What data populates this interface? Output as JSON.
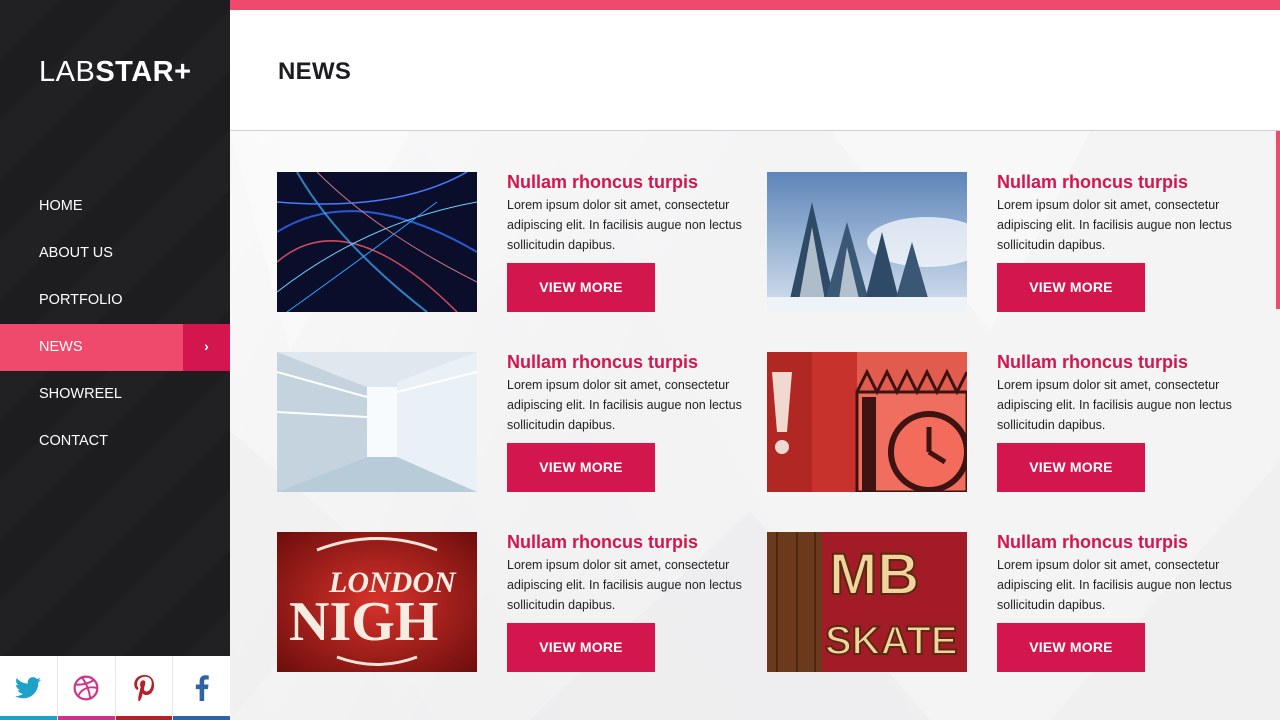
{
  "brand": {
    "logo_light": "LAB",
    "logo_bold": "STAR",
    "logo_plus": "+"
  },
  "nav": {
    "items": [
      {
        "label": "HOME"
      },
      {
        "label": "ABOUT US"
      },
      {
        "label": "PORTFOLIO"
      },
      {
        "label": "NEWS",
        "active": true,
        "chevron": "›"
      },
      {
        "label": "SHOWREEL"
      },
      {
        "label": "CONTACT"
      }
    ]
  },
  "social": [
    {
      "icon": "twitter-icon",
      "color": "#1da1c8"
    },
    {
      "icon": "dribbble-icon",
      "color": "#d4308a"
    },
    {
      "icon": "pinterest-icon",
      "color": "#b5202a"
    },
    {
      "icon": "facebook-icon",
      "color": "#2f63a8"
    }
  ],
  "page": {
    "title": "NEWS"
  },
  "colors": {
    "accent": "#ef4a6b",
    "accent_dark": "#d4164f",
    "sidebar": "#1d1d1f"
  },
  "news": [
    {
      "title": "Nullam rhoncus turpis",
      "body": "Lorem ipsum dolor sit amet, consectetur adipiscing elit. In facilisis augue non lectus sollicitudin dapibus.",
      "button": "VIEW MORE",
      "image": "light-streaks"
    },
    {
      "title": "Nullam rhoncus turpis",
      "body": "Lorem ipsum dolor sit amet, consectetur adipiscing elit. In facilisis augue non lectus sollicitudin dapibus.",
      "button": "VIEW MORE",
      "image": "snowy-trees"
    },
    {
      "title": "Nullam rhoncus turpis",
      "body": "Lorem ipsum dolor sit amet, consectetur adipiscing elit. In facilisis augue non lectus sollicitudin dapibus.",
      "button": "VIEW MORE",
      "image": "white-corridor"
    },
    {
      "title": "Nullam rhoncus turpis",
      "body": "Lorem ipsum dolor sit amet, consectetur adipiscing elit. In facilisis augue non lectus sollicitudin dapibus.",
      "button": "VIEW MORE",
      "image": "clock-tower"
    },
    {
      "title": "Nullam rhoncus turpis",
      "body": "Lorem ipsum dolor sit amet, consectetur adipiscing elit. In facilisis augue non lectus sollicitudin dapibus.",
      "button": "VIEW MORE",
      "image": "london-nights",
      "image_text_1": "LONDON",
      "image_text_2": "NIGH"
    },
    {
      "title": "Nullam rhoncus turpis",
      "body": "Lorem ipsum dolor sit amet, consectetur adipiscing elit. In facilisis augue non lectus sollicitudin dapibus.",
      "button": "VIEW MORE",
      "image": "mb-skate",
      "image_text_1": "MB",
      "image_text_2": "SKATE"
    }
  ]
}
